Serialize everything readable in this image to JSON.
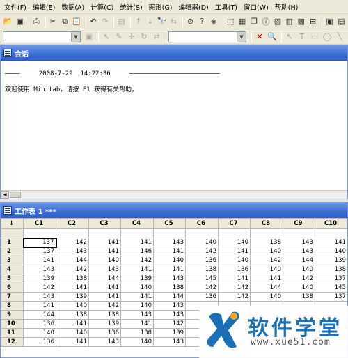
{
  "menubar": {
    "items": [
      "文件(F)",
      "编辑(E)",
      "数据(A)",
      "计算(C)",
      "统计(S)",
      "图形(G)",
      "编辑器(D)",
      "工具(T)",
      "窗口(W)",
      "帮助(H)"
    ]
  },
  "toolbar1": {
    "icons": [
      "open-folder-icon",
      "save-icon",
      "print-icon",
      "cut-icon",
      "copy-icon",
      "paste-icon",
      "undo-icon",
      "redo-icon",
      "show-session-icon",
      "up-arrow-icon",
      "down-arrow-icon",
      "find-icon",
      "replace-icon",
      "cancel-icon",
      "help-icon",
      "cube-icon",
      "graph-icon",
      "worksheet-icon",
      "info-icon",
      "history-icon",
      "report-icon",
      "project-manager-icon",
      "close-all-icon",
      "related-icon"
    ]
  },
  "toolbar2": {
    "combo1": "",
    "combo2": ""
  },
  "session": {
    "title": "会话",
    "line1": "————     2008-7-29  14:22:36     ————————————————————————",
    "line2": "欢迎使用 Minitab，请按 F1 获得有关帮助。"
  },
  "worksheet": {
    "title": "工作表 1 ***",
    "corner": "↓",
    "columns": [
      "C1",
      "C2",
      "C3",
      "C4",
      "C5",
      "C6",
      "C7",
      "C8",
      "C9",
      "C10"
    ],
    "rows": [
      {
        "n": "1",
        "v": [
          "137",
          "142",
          "141",
          "141",
          "143",
          "140",
          "140",
          "138",
          "143",
          "141"
        ]
      },
      {
        "n": "2",
        "v": [
          "137",
          "143",
          "141",
          "146",
          "141",
          "142",
          "141",
          "140",
          "143",
          "140"
        ]
      },
      {
        "n": "3",
        "v": [
          "141",
          "144",
          "140",
          "142",
          "140",
          "136",
          "140",
          "142",
          "144",
          "139"
        ]
      },
      {
        "n": "4",
        "v": [
          "143",
          "142",
          "143",
          "141",
          "141",
          "138",
          "136",
          "140",
          "140",
          "138"
        ]
      },
      {
        "n": "5",
        "v": [
          "139",
          "138",
          "144",
          "139",
          "143",
          "145",
          "141",
          "141",
          "142",
          "137"
        ]
      },
      {
        "n": "6",
        "v": [
          "142",
          "141",
          "141",
          "140",
          "138",
          "142",
          "142",
          "144",
          "140",
          "145"
        ]
      },
      {
        "n": "7",
        "v": [
          "143",
          "139",
          "141",
          "141",
          "144",
          "136",
          "142",
          "140",
          "138",
          "137"
        ]
      },
      {
        "n": "8",
        "v": [
          "141",
          "140",
          "142",
          "140",
          "143",
          "",
          "",
          "",
          "",
          ""
        ]
      },
      {
        "n": "9",
        "v": [
          "144",
          "138",
          "138",
          "143",
          "143",
          "",
          "",
          "",
          "",
          ""
        ]
      },
      {
        "n": "10",
        "v": [
          "136",
          "141",
          "139",
          "141",
          "142",
          "",
          "",
          "",
          "",
          ""
        ]
      },
      {
        "n": "11",
        "v": [
          "140",
          "140",
          "136",
          "138",
          "139",
          "",
          "",
          "",
          "",
          ""
        ]
      },
      {
        "n": "12",
        "v": [
          "136",
          "141",
          "143",
          "140",
          "143",
          "",
          "",
          "",
          "",
          ""
        ]
      }
    ]
  },
  "watermark": {
    "title": "软件学堂",
    "url": "www.xue51.com",
    "color": "#1b6fb5"
  }
}
